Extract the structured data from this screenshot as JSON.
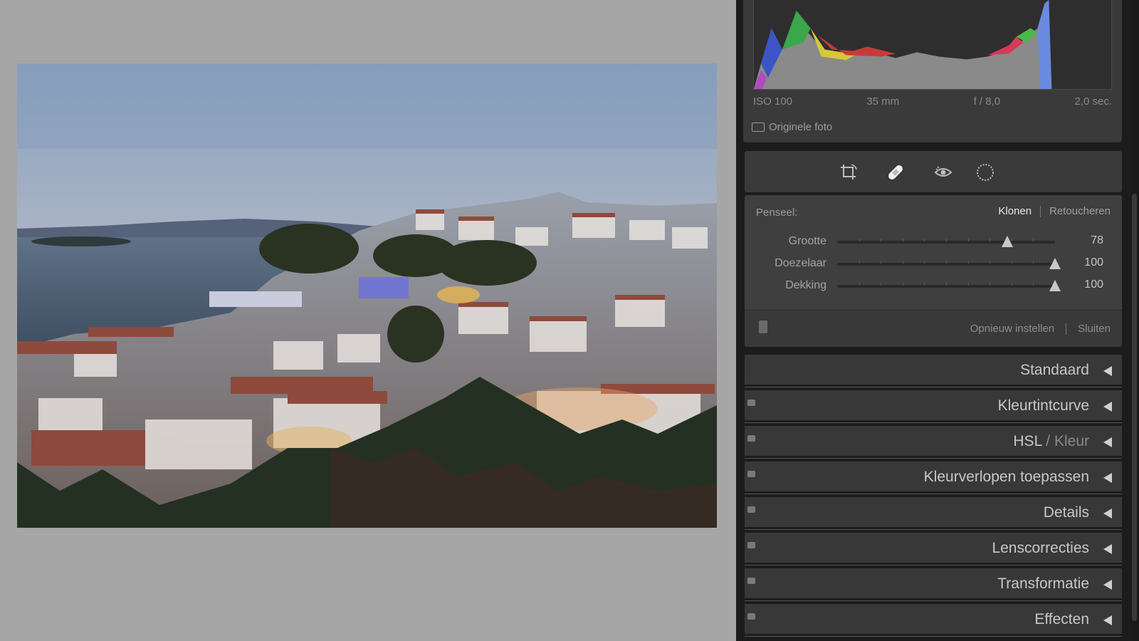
{
  "exif": {
    "iso": "ISO 100",
    "focal": "35 mm",
    "aperture": "f / 8,0",
    "shutter": "2,0 sec."
  },
  "original_photo": {
    "label": "Originele foto",
    "checked": false
  },
  "tools": [
    "crop-icon",
    "spot-removal-icon",
    "red-eye-icon",
    "mask-icon"
  ],
  "spot_removal": {
    "brush_label": "Penseel:",
    "mode_clone": "Klonen",
    "mode_heal": "Retoucheren",
    "active_mode": "clone",
    "sliders": [
      {
        "label": "Grootte",
        "value": "78",
        "level": 0.78
      },
      {
        "label": "Doezelaar",
        "value": "100",
        "level": 1.0
      },
      {
        "label": "Dekking",
        "value": "100",
        "level": 1.0
      }
    ],
    "reset_label": "Opnieuw instellen",
    "close_label": "Sluiten"
  },
  "sections": [
    {
      "title": "Standaard",
      "has_switch": false
    },
    {
      "title": "Kleurtintcurve",
      "has_switch": true
    },
    {
      "title": "HSL",
      "title_suffix": " / Kleur",
      "has_switch": true
    },
    {
      "title": "Kleurverlopen toepassen",
      "has_switch": true
    },
    {
      "title": "Details",
      "has_switch": true
    },
    {
      "title": "Lenscorrecties",
      "has_switch": true
    },
    {
      "title": "Transformatie",
      "has_switch": true
    },
    {
      "title": "Effecten",
      "has_switch": true
    }
  ]
}
